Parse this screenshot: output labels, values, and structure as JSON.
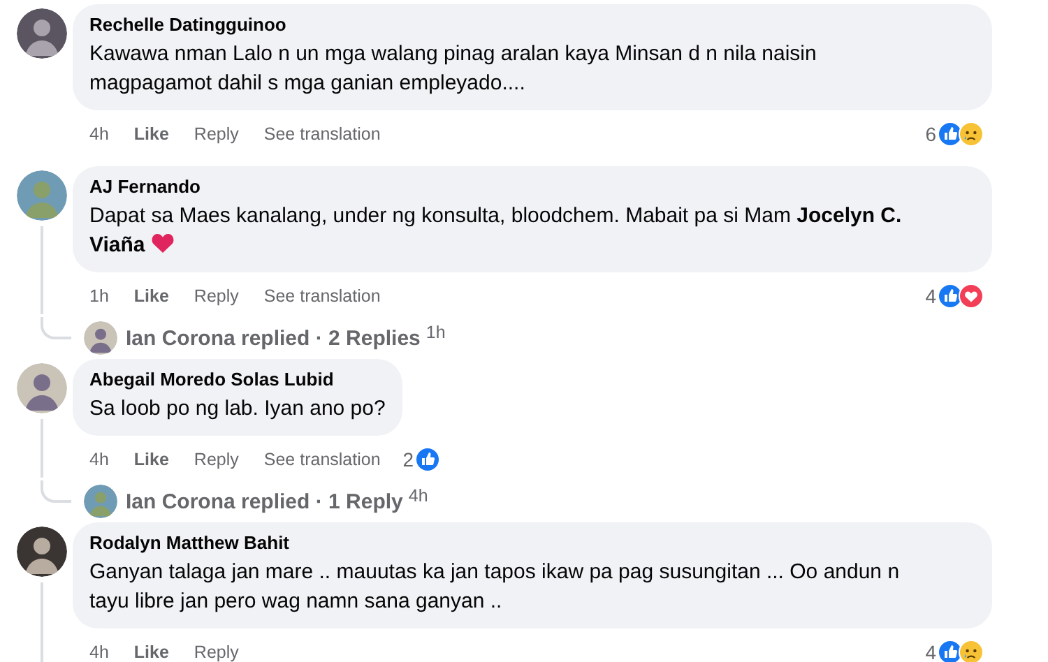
{
  "comments": [
    {
      "author": "Rechelle Datingguinoo",
      "text": "Kawawa nman Lalo n un mga walang pinag aralan kaya Minsan d n nila naisin magpagamot dahil s mga ganian empleyado....",
      "time": "4h",
      "actions": [
        "Like",
        "Reply",
        "See translation"
      ],
      "reactions": {
        "count": "6",
        "icons": [
          {
            "kind": "like"
          },
          {
            "kind": "sad"
          }
        ]
      },
      "wide": true
    },
    {
      "author": "AJ Fernando",
      "text": "Dapat sa Maes kanalang, under ng konsulta, bloodchem. Mabait pa si Mam **Jocelyn C. Viaña**",
      "trailing_icon": {
        "kind": "heart"
      },
      "time": "1h",
      "actions": [
        "Like",
        "Reply",
        "See translation"
      ],
      "reactions": {
        "count": "4",
        "icons": [
          {
            "kind": "like"
          },
          {
            "kind": "love"
          }
        ]
      },
      "wide": true,
      "reply_summary": {
        "text": "Ian Corona replied · 2 Replies",
        "time": "1h"
      }
    },
    {
      "author": "Abegail Moredo Solas Lubid",
      "text": "Sa loob po ng lab. Iyan ano po?",
      "time": "4h",
      "actions": [
        "Like",
        "Reply",
        "See translation"
      ],
      "reactions": {
        "count": "2",
        "icons": [
          {
            "kind": "like"
          }
        ]
      },
      "wide": false,
      "reply_summary": {
        "text": "Ian Corona replied · 1 Reply",
        "time": "4h"
      }
    },
    {
      "author": "Rodalyn Matthew Bahit",
      "text": "Ganyan talaga jan mare .. mauutas ka jan tapos ikaw pa pag susungitan ... Oo andun n tayu libre jan pero wag namn sana ganyan ..",
      "time": "4h",
      "actions": [
        "Like",
        "Reply"
      ],
      "reactions": {
        "count": "4",
        "icons": [
          {
            "kind": "like"
          },
          {
            "kind": "sad"
          }
        ]
      },
      "wide": true,
      "thread_continues": true
    }
  ]
}
